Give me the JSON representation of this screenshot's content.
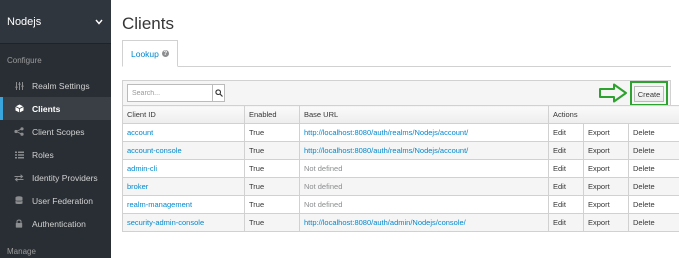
{
  "sidebar": {
    "realm": "Nodejs",
    "configure_label": "Configure",
    "manage_label": "Manage",
    "items": [
      {
        "label": "Realm Settings",
        "icon": "sliders-icon"
      },
      {
        "label": "Clients",
        "icon": "cube-icon",
        "active": true
      },
      {
        "label": "Client Scopes",
        "icon": "share-icon"
      },
      {
        "label": "Roles",
        "icon": "list-icon"
      },
      {
        "label": "Identity Providers",
        "icon": "exchange-icon"
      },
      {
        "label": "User Federation",
        "icon": "database-icon"
      },
      {
        "label": "Authentication",
        "icon": "lock-icon"
      }
    ]
  },
  "main": {
    "title": "Clients",
    "tab_label": "Lookup",
    "search_placeholder": "Search...",
    "create_label": "Create",
    "columns": [
      "Client ID",
      "Enabled",
      "Base URL",
      "Actions"
    ],
    "rows": [
      {
        "client_id": "account",
        "enabled": "True",
        "base_url": "http://localhost:8080/auth/realms/Nodejs/account/",
        "defined": true
      },
      {
        "client_id": "account-console",
        "enabled": "True",
        "base_url": "http://localhost:8080/auth/realms/Nodejs/account/",
        "defined": true
      },
      {
        "client_id": "admin-cli",
        "enabled": "True",
        "base_url": "Not defined",
        "defined": false
      },
      {
        "client_id": "broker",
        "enabled": "True",
        "base_url": "Not defined",
        "defined": false
      },
      {
        "client_id": "realm-management",
        "enabled": "True",
        "base_url": "Not defined",
        "defined": false
      },
      {
        "client_id": "security-admin-console",
        "enabled": "True",
        "base_url": "http://localhost:8080/auth/admin/Nodejs/console/",
        "defined": true
      }
    ],
    "actions": [
      "Edit",
      "Export",
      "Delete"
    ]
  },
  "colors": {
    "sidebar_bg": "#292e34",
    "accent": "#39a5dc",
    "link": "#0088ce",
    "annotation_green": "#2ea22e"
  }
}
